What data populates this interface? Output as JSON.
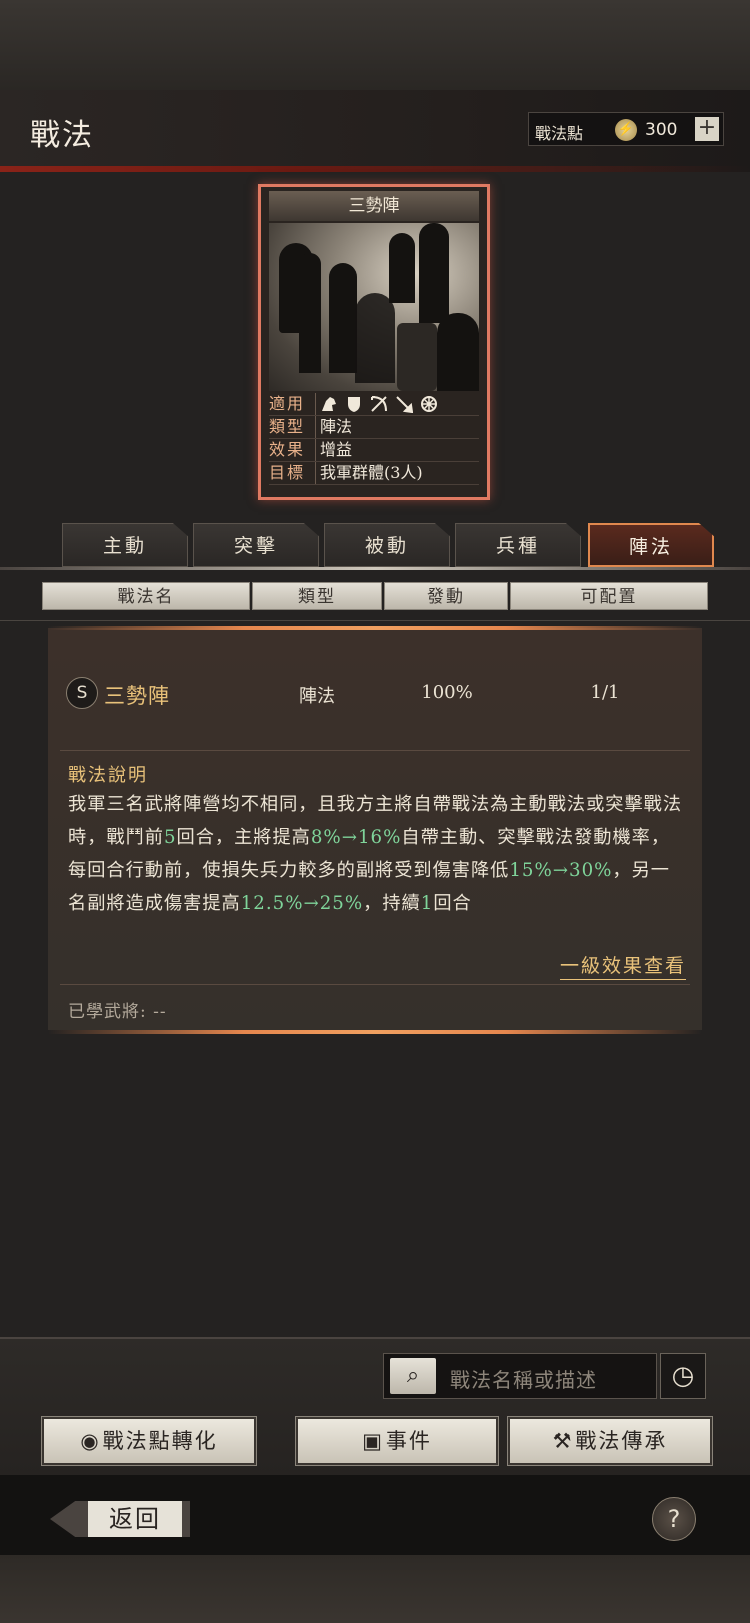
{
  "header": {
    "title": "戰法",
    "points_label": "戰法點",
    "points_value": "300",
    "plus_label": "+"
  },
  "card": {
    "name": "三勢陣",
    "rows": [
      {
        "key": "適用",
        "value": ""
      },
      {
        "key": "類型",
        "value": "陣法"
      },
      {
        "key": "效果",
        "value": "增益"
      },
      {
        "key": "目標",
        "value": "我軍群體(3人)"
      }
    ],
    "troop_icons": [
      "cavalry-icon",
      "shield-icon",
      "bow-icon",
      "spear-icon",
      "wheel-icon"
    ]
  },
  "tabs": [
    {
      "label": "主動",
      "active": false
    },
    {
      "label": "突擊",
      "active": false
    },
    {
      "label": "被動",
      "active": false
    },
    {
      "label": "兵種",
      "active": false
    },
    {
      "label": "陣法",
      "active": true
    }
  ],
  "columns": [
    "戰法名",
    "類型",
    "發動",
    "可配置"
  ],
  "entry": {
    "grade": "S",
    "name": "三勢陣",
    "type": "陣法",
    "rate": "100%",
    "count": "1/1",
    "desc_title": "戰法說明",
    "desc_parts": [
      "我軍三名武將陣營均不相同，且我方主將自帶戰法為主動戰法或突擊戰法時，戰鬥前",
      "5",
      "回合，主將提高",
      "8%→16%",
      "自帶主動、突擊戰法發動機率，每回合行動前，使損失兵力較多的副將受到傷害降低",
      "15%→30%",
      "，另一名副將造成傷害提高",
      "12.5%→25%",
      "，持續",
      "1",
      "回合"
    ],
    "more_link": "一級效果查看",
    "learned": "已學武將: --"
  },
  "search": {
    "placeholder": "戰法名稱或描述"
  },
  "buttons": {
    "convert": "戰法點轉化",
    "event": "事件",
    "inherit": "戰法傳承"
  },
  "footer": {
    "back": "返回",
    "help": "?"
  }
}
